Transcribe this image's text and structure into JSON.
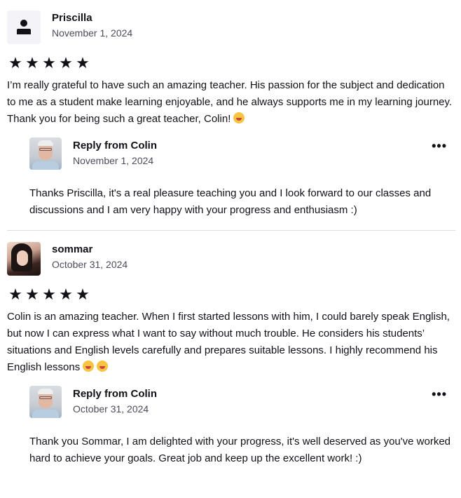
{
  "reviews": [
    {
      "author": "Priscilla",
      "date": "November 1, 2024",
      "avatar": "user-placeholder-icon",
      "rating": 5,
      "stars": [
        "★",
        "★",
        "★",
        "★",
        "★"
      ],
      "text": "I’m really grateful to have such an amazing teacher. His passion for the subject and dedication to me as a student make learning enjoyable, and he always supports me in my learning journey. Thank you for being such a great teacher, Colin!",
      "emojis": [
        "grinning-face-emoji"
      ],
      "reply": {
        "title": "Reply from Colin",
        "date": "November 1, 2024",
        "text": "Thanks Priscilla, it's a real pleasure teaching you and I look forward to our classes and discussions and I am very happy with your progress and enthusiasm :)",
        "more_label": "•••"
      }
    },
    {
      "author": "sommar",
      "date": "October 31, 2024",
      "avatar": "user-photo",
      "rating": 5,
      "stars": [
        "★",
        "★",
        "★",
        "★",
        "★"
      ],
      "text": "Colin is an amazing teacher. When I first started lessons with him, I could barely speak English, but now I can express what I want to say without much trouble. He considers his students’ situations and English levels carefully and prepares suitable lessons. I highly recommend his English lessons",
      "emojis": [
        "grinning-face-emoji",
        "grinning-face-emoji"
      ],
      "reply": {
        "title": "Reply from Colin",
        "date": "October 31, 2024",
        "text": "Thank you Sommar, I am delighted with your progress, it's well deserved as you've worked hard to achieve your goals. Great job and keep up the excellent work! :)",
        "more_label": "•••"
      }
    }
  ],
  "colors": {
    "text": "#121117",
    "muted": "#4d4c5c",
    "divider": "#dcdce5",
    "emoji": "#f6c343"
  }
}
